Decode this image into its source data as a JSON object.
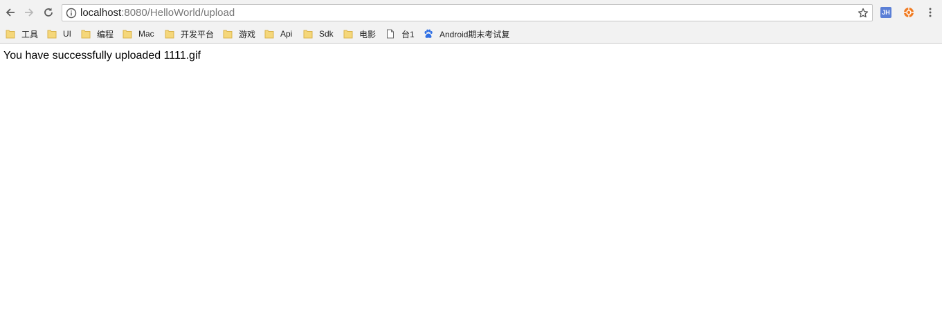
{
  "address_bar": {
    "url_host": "localhost",
    "url_rest": ":8080/HelloWorld/upload"
  },
  "extensions": {
    "jh_label": "JH"
  },
  "bookmarks": [
    {
      "label": "工具",
      "icon": "folder-icon"
    },
    {
      "label": "UI",
      "icon": "folder-icon"
    },
    {
      "label": "编程",
      "icon": "folder-icon"
    },
    {
      "label": "Mac",
      "icon": "folder-icon"
    },
    {
      "label": "开发平台",
      "icon": "folder-icon"
    },
    {
      "label": "游戏",
      "icon": "folder-icon"
    },
    {
      "label": "Api",
      "icon": "folder-icon"
    },
    {
      "label": "Sdk",
      "icon": "folder-icon"
    },
    {
      "label": "电影",
      "icon": "folder-icon"
    },
    {
      "label": "台1",
      "icon": "page-icon"
    },
    {
      "label": "Android期末考试复",
      "icon": "baidu-paw-icon"
    }
  ],
  "page": {
    "message": "You have successfully uploaded 1111.gif"
  },
  "colors": {
    "folder": "#f5d77a",
    "folder_edge": "#d9b34a",
    "baidu": "#2f6fe4",
    "jh_ext": "#5b7fd6",
    "orange_ext": "#f07b22"
  }
}
